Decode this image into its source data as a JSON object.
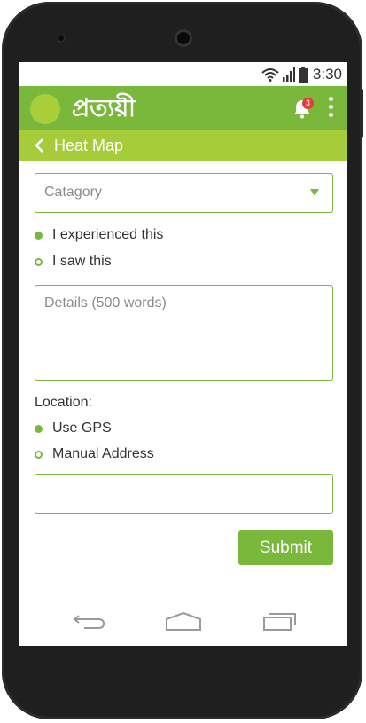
{
  "status_bar": {
    "time": "3:30",
    "icons": [
      "wifi-icon",
      "signal-icon",
      "battery-icon"
    ]
  },
  "app_bar": {
    "brand": "প্রত্যয়ী",
    "notification_count": "3"
  },
  "sub_header": {
    "title": "Heat Map"
  },
  "form": {
    "category_placeholder": "Catagory",
    "experience_options": [
      {
        "label": "I experienced this",
        "selected": true
      },
      {
        "label": "I saw this",
        "selected": false
      }
    ],
    "details_placeholder": "Details (500 words)",
    "location_label": "Location:",
    "location_options": [
      {
        "label": "Use GPS",
        "selected": true
      },
      {
        "label": "Manual Address",
        "selected": false
      }
    ],
    "address_value": "",
    "submit_label": "Submit"
  },
  "nav_bar": {
    "icons": [
      "back-nav-icon",
      "home-nav-icon",
      "recents-nav-icon"
    ]
  },
  "colors": {
    "primary": "#7ab83c",
    "secondary": "#a6cc3a",
    "badge": "#e23b3b"
  }
}
